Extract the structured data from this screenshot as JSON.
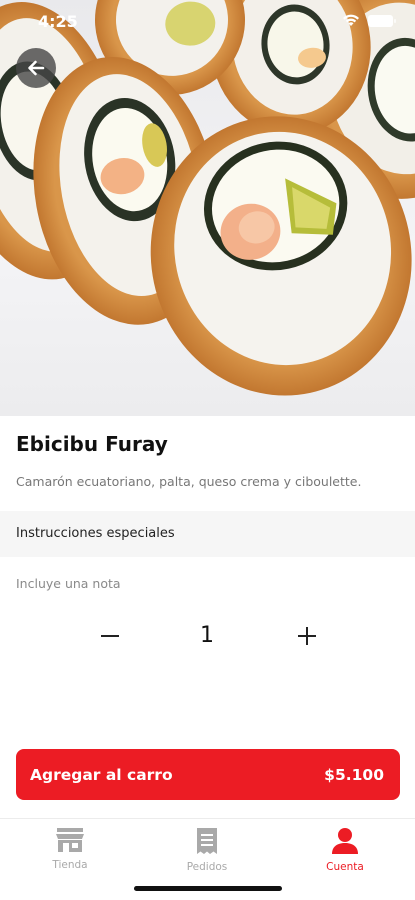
{
  "status_bar": {
    "time": "4:25"
  },
  "hero": {
    "image": "ebicibu-furay-sushi-photo"
  },
  "header": {
    "back_icon": "arrow-left-icon"
  },
  "product": {
    "name": "Ebicibu Furay",
    "description": "Camarón ecuatoriano, palta, queso crema y ciboulette."
  },
  "special_instructions": {
    "title": "Instrucciones especiales",
    "placeholder": "Incluye una nota",
    "value": ""
  },
  "quantity": {
    "value": "1",
    "minus_icon": "minus-icon",
    "plus_icon": "plus-icon"
  },
  "cart_button": {
    "label": "Agregar al carro",
    "price": "$5.100"
  },
  "tabs": [
    {
      "label": "Tienda",
      "icon": "store-icon",
      "active": false
    },
    {
      "label": "Pedidos",
      "icon": "receipt-icon",
      "active": false
    },
    {
      "label": "Cuenta",
      "icon": "user-icon",
      "active": true
    }
  ],
  "colors": {
    "accent": "#ec1c24",
    "inactive": "#a9a9a9"
  }
}
